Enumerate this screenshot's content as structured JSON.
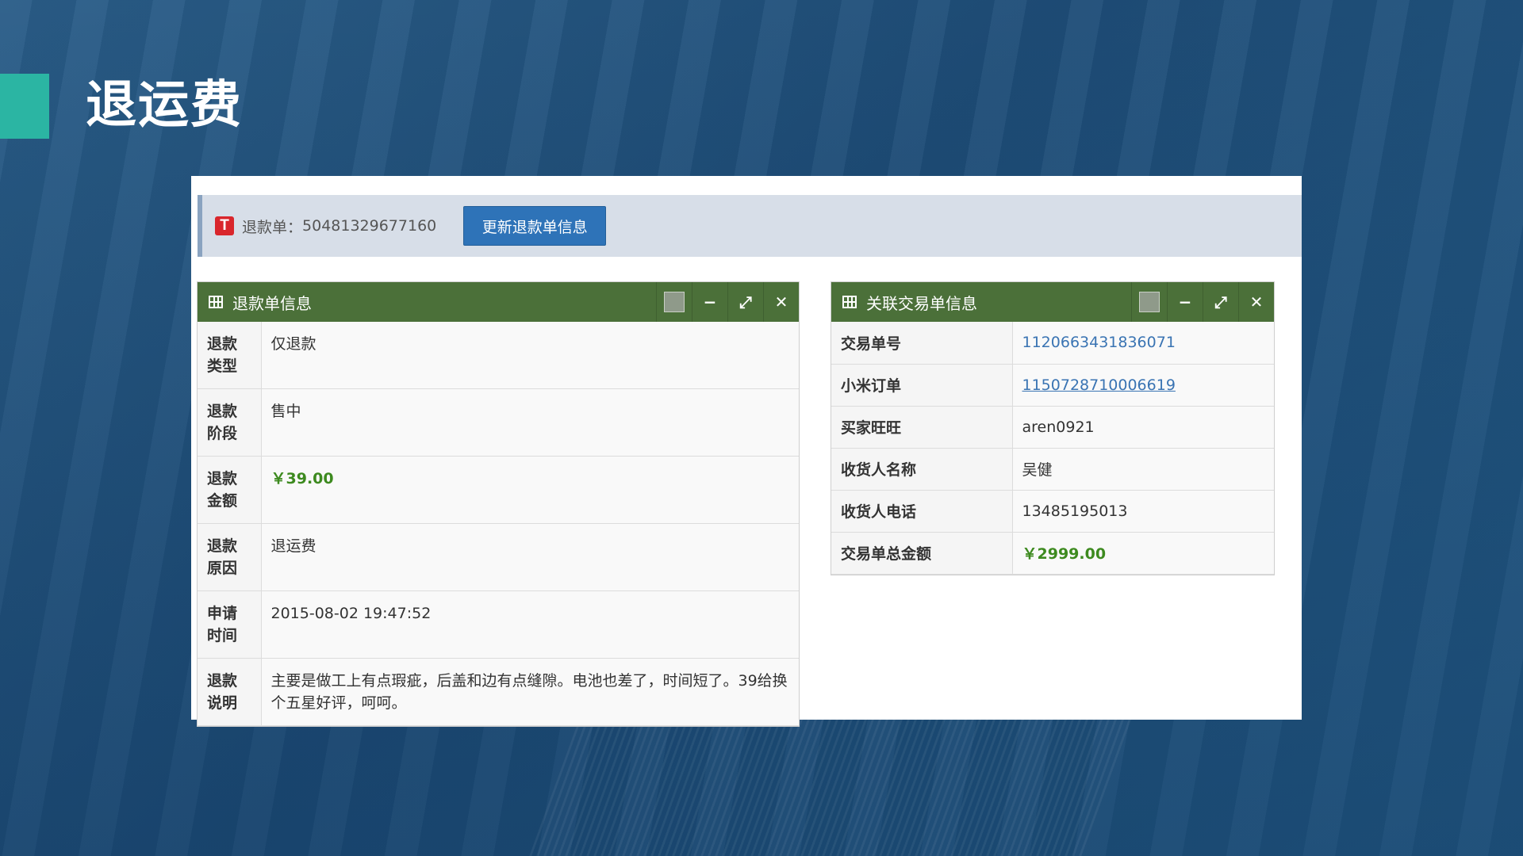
{
  "slide": {
    "title": "退运费"
  },
  "toolbar": {
    "icon_letter": "T",
    "order_label": "退款单：",
    "order_no": "50481329677160",
    "update_button": "更新退款单信息"
  },
  "refund_box": {
    "title": "退款单信息",
    "rows": [
      {
        "key": "退款\n类型",
        "value": "仅退款"
      },
      {
        "key": "退款\n阶段",
        "value": "售中"
      },
      {
        "key": "退款\n金额",
        "value": "￥39.00"
      },
      {
        "key": "退款\n原因",
        "value": "退运费"
      },
      {
        "key": "申请\n时间",
        "value": "2015-08-02 19:47:52"
      },
      {
        "key": "退款\n说明",
        "value": "主要是做工上有点瑕疵，后盖和边有点缝隙。电池也差了，时间短了。39给换个五星好评，呵呵。"
      }
    ]
  },
  "trade_box": {
    "title": "关联交易单信息",
    "rows": [
      {
        "key": "交易单号",
        "value": "1120663431836071"
      },
      {
        "key": "小米订单",
        "value": "1150728710006619"
      },
      {
        "key": "买家旺旺",
        "value": "aren0921"
      },
      {
        "key": "收货人名称",
        "value": "吴健"
      },
      {
        "key": "收货人电话",
        "value": "13485195013"
      },
      {
        "key": "交易单总金额",
        "value": "￥2999.00"
      }
    ]
  },
  "header_buttons": {
    "minimize": "−",
    "expand": "⤢",
    "close": "✕"
  },
  "colors": {
    "accent": "#2bb5a3",
    "box_header": "#4b7039",
    "money": "#3d8a1f",
    "link": "#3a74b3",
    "button": "#2e73b8"
  }
}
